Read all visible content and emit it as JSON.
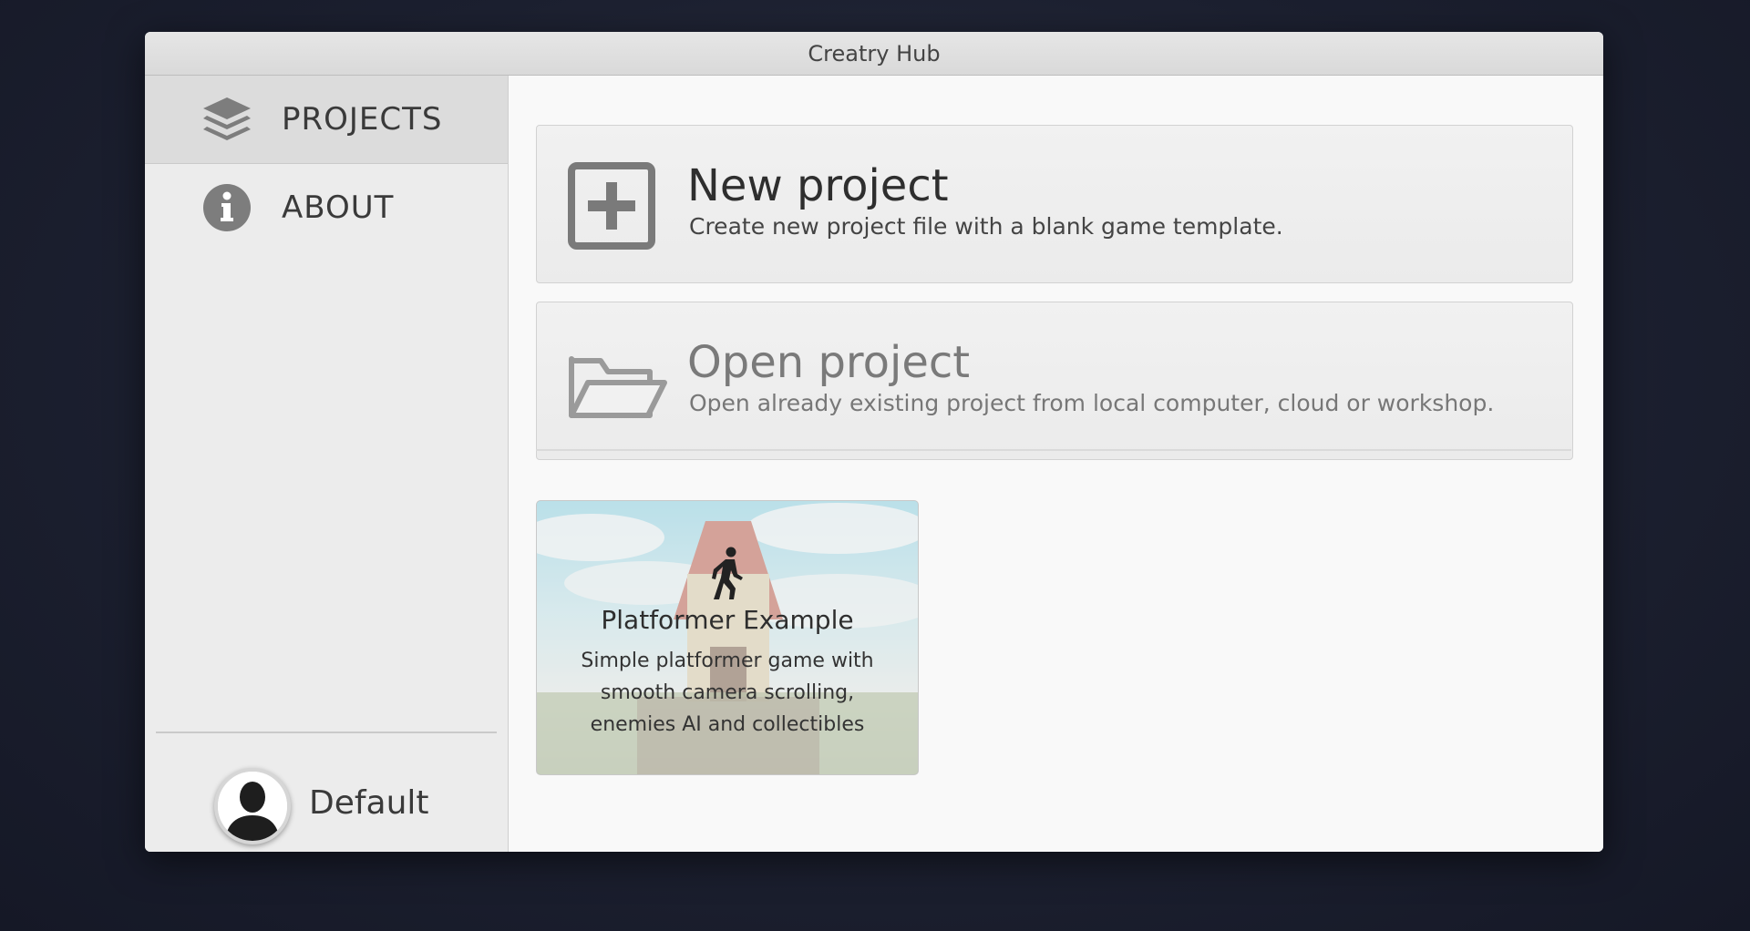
{
  "window": {
    "title": "Creatry Hub"
  },
  "sidebar": {
    "items": [
      {
        "label": "PROJECTS",
        "icon": "layers-icon",
        "active": true
      },
      {
        "label": "ABOUT",
        "icon": "info-icon",
        "active": false
      }
    ],
    "user": {
      "name": "Default",
      "icon": "user-avatar-icon"
    }
  },
  "main": {
    "actions": [
      {
        "title": "New project",
        "description": "Create new project file with a blank game template.",
        "icon": "plus-square-icon"
      },
      {
        "title": "Open project",
        "description": "Open already existing project from local computer, cloud or workshop.",
        "icon": "folder-open-icon"
      }
    ],
    "templates": [
      {
        "title": "Platformer Example",
        "description": "Simple platformer game with smooth camera scrolling, enemies AI and collectibles",
        "icon": "walking-person-icon"
      }
    ]
  },
  "colors": {
    "background": "#1c2030",
    "window": "#f5f5f5",
    "sidebar": "#ececec",
    "sidebar_active": "#dcdcdc",
    "text": "#3a3a3a"
  }
}
